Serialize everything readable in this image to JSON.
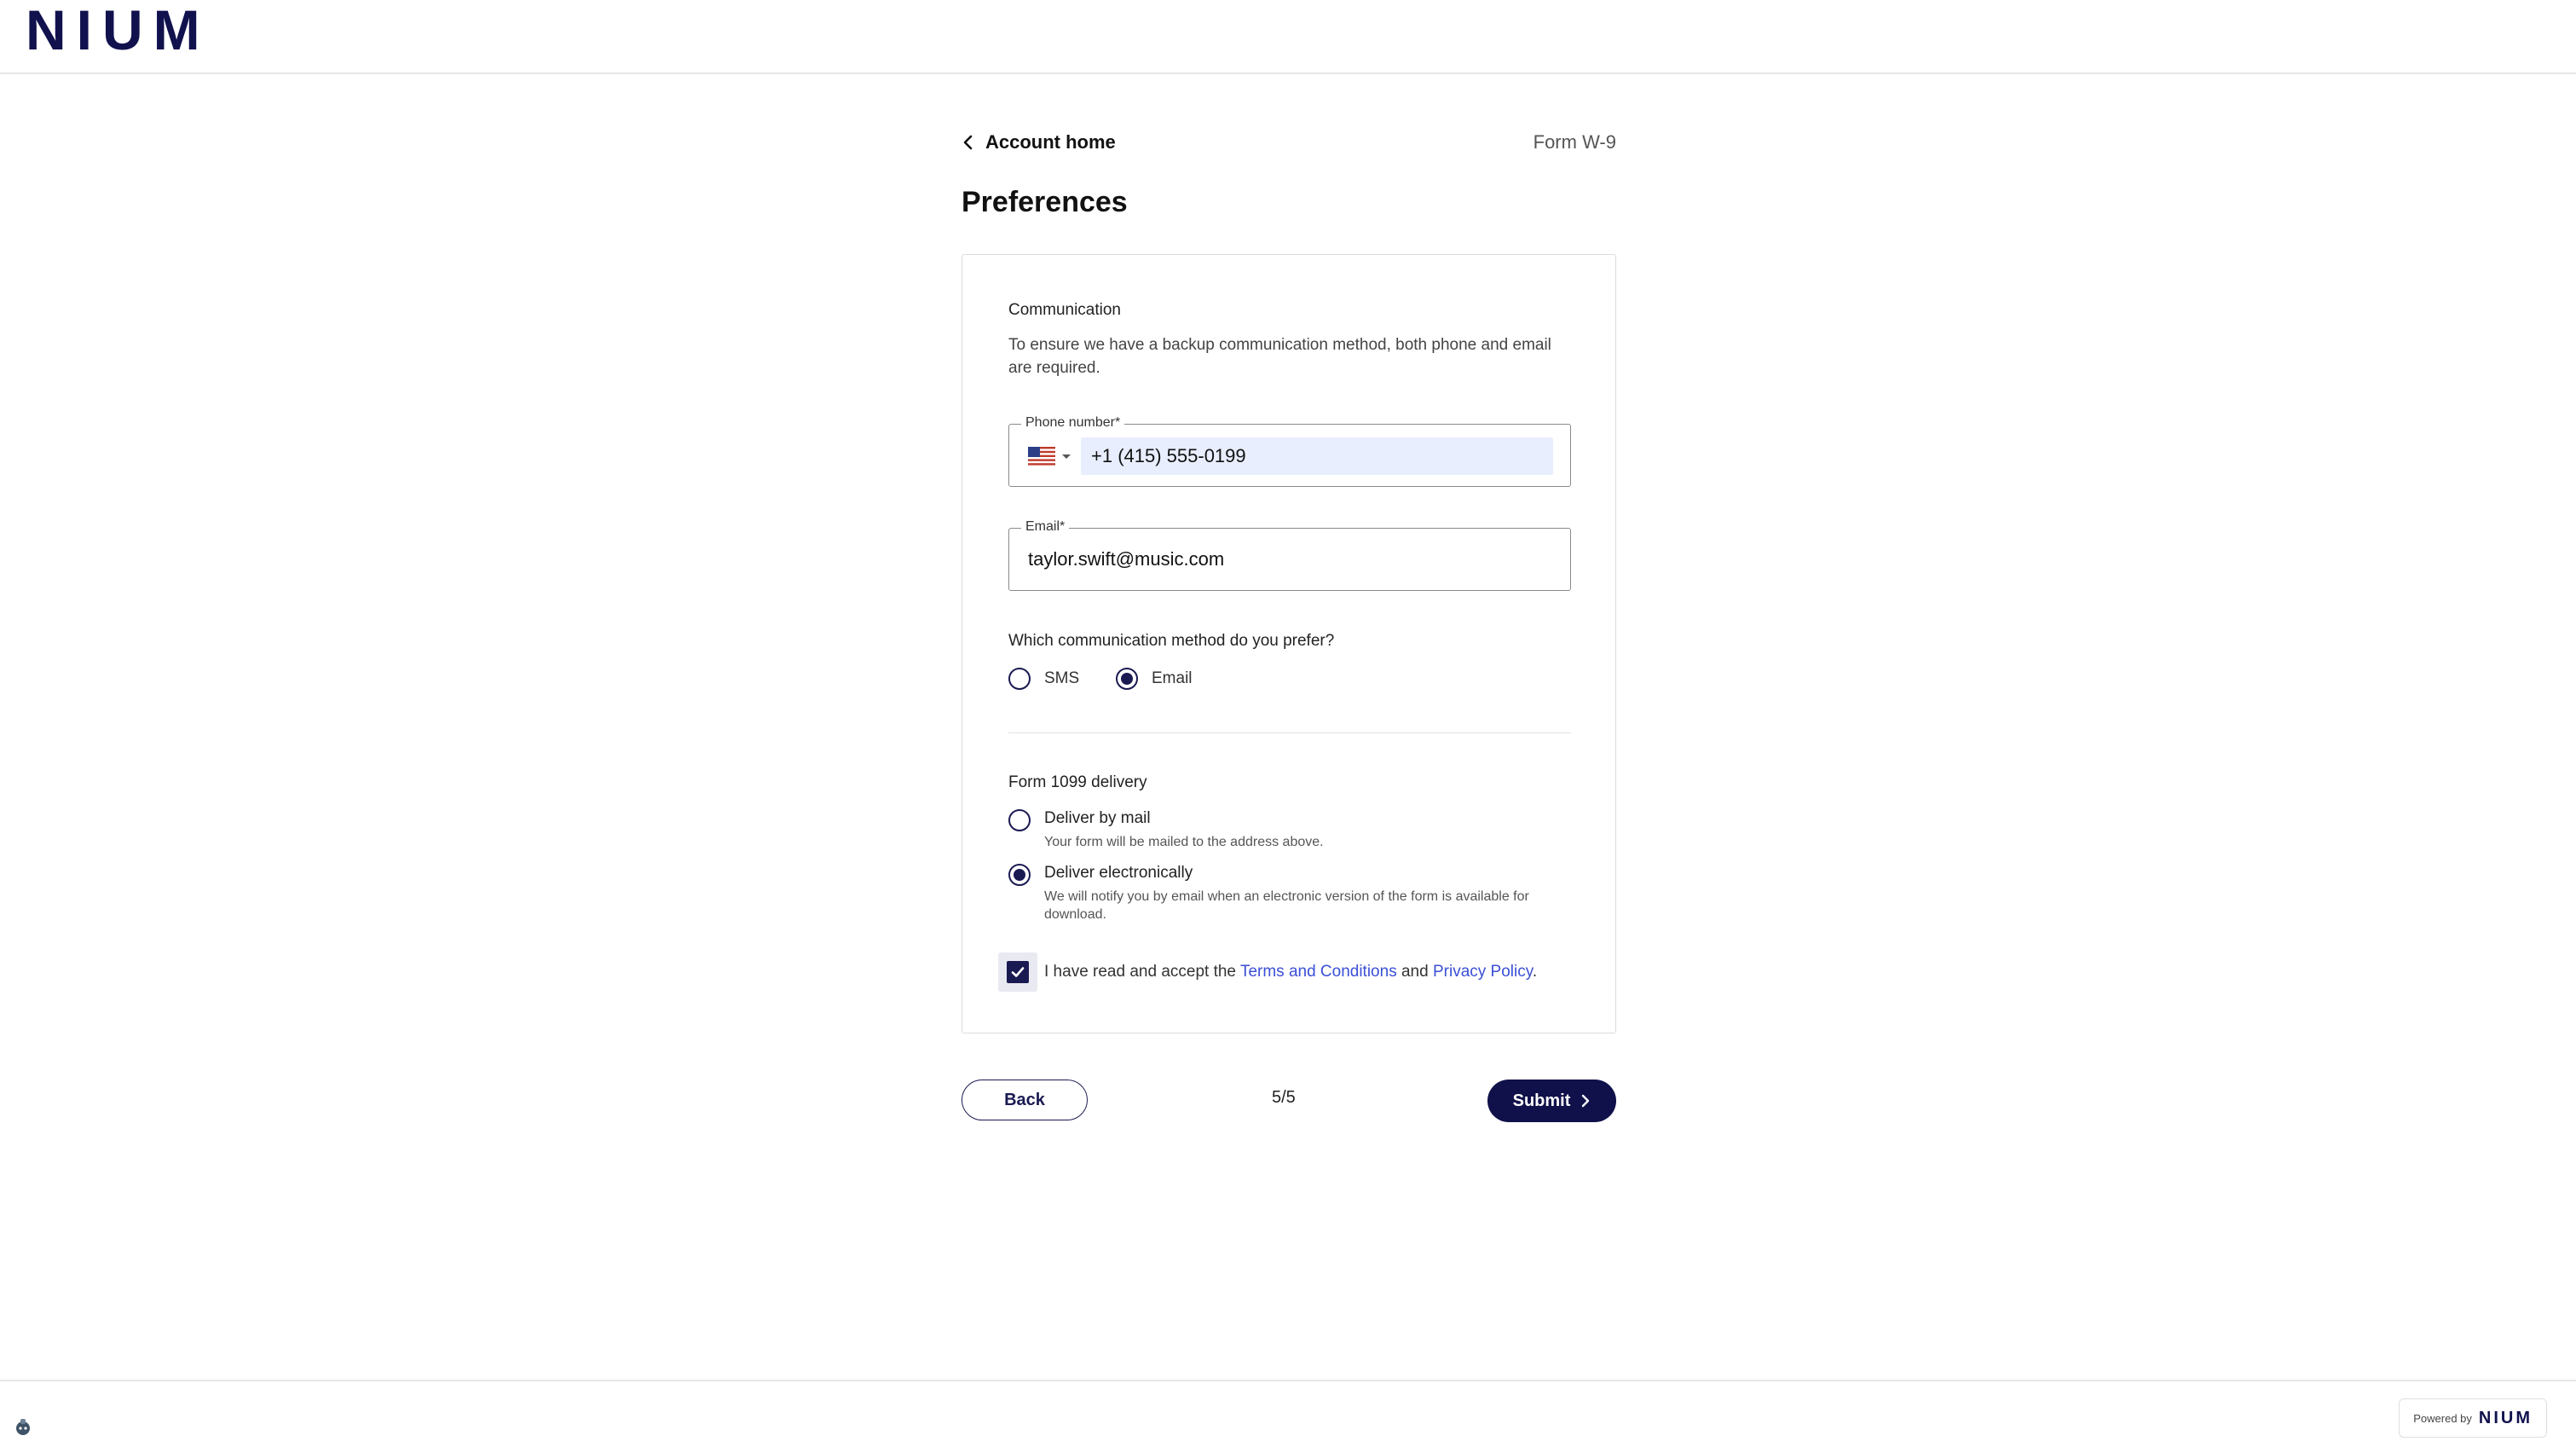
{
  "header": {
    "logo_text": "NIUM"
  },
  "nav": {
    "back_label": "Account home",
    "form_code": "Form W-9"
  },
  "page": {
    "title": "Preferences"
  },
  "communication": {
    "title": "Communication",
    "helper": "To ensure we have a backup communication method, both phone and email are required.",
    "phone": {
      "label": "Phone number*",
      "country_flag": "us-flag-icon",
      "value": "+1 (415) 555-0199"
    },
    "email": {
      "label": "Email*",
      "value": "taylor.swift@music.com"
    },
    "method_question": "Which communication method do you prefer?",
    "methods": [
      {
        "label": "SMS",
        "selected": false
      },
      {
        "label": "Email",
        "selected": true
      }
    ]
  },
  "delivery": {
    "title": "Form 1099 delivery",
    "options": [
      {
        "label": "Deliver by mail",
        "sub": "Your form will be mailed to the address above.",
        "selected": false
      },
      {
        "label": "Deliver electronically",
        "sub": "We will notify you by email when an electronic version of the form is available for download.",
        "selected": true
      }
    ]
  },
  "terms": {
    "checked": true,
    "prefix": "I have read and accept the ",
    "terms_link": "Terms and Conditions",
    "joiner": " and ",
    "privacy_link": "Privacy Policy",
    "suffix": "."
  },
  "footer_nav": {
    "back_label": "Back",
    "page_indicator": "5/5",
    "submit_label": "Submit"
  },
  "footer": {
    "powered_by": "Powered by",
    "powered_logo": "NIUM"
  },
  "colors": {
    "brand": "#10104a",
    "link": "#3b4fd6",
    "autofill": "#e8eefe"
  }
}
